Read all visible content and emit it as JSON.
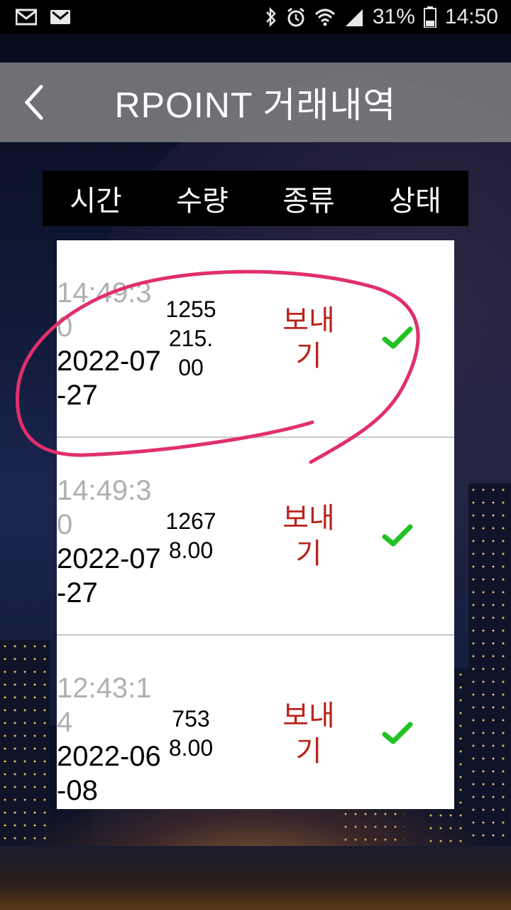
{
  "status_bar": {
    "battery": "31%",
    "time": "14:50",
    "icons": [
      "email-icon",
      "gmail-icon",
      "bluetooth-icon",
      "alarm-icon",
      "wifi-icon",
      "signal-icon",
      "battery-icon"
    ]
  },
  "header": {
    "title": "RPOINT 거래내역",
    "back_icon": "chevron-left-icon"
  },
  "columns": [
    "시간",
    "수량",
    "종류",
    "상태"
  ],
  "transactions": [
    {
      "time": "14:49:30",
      "date": "2022-07-27",
      "amount": "1255215.00",
      "type": "보내기",
      "status_icon": "check-icon"
    },
    {
      "time": "14:49:30",
      "date": "2022-07-27",
      "amount": "12678.00",
      "type": "보내기",
      "status_icon": "check-icon"
    },
    {
      "time": "12:43:14",
      "date": "2022-06-08",
      "amount": "7538.00",
      "type": "보내기",
      "status_icon": "check-icon"
    }
  ],
  "colors": {
    "accent_type": "#b8241c",
    "check": "#22c222",
    "annotation": "#e0306a",
    "header_bg": "#78787d"
  }
}
